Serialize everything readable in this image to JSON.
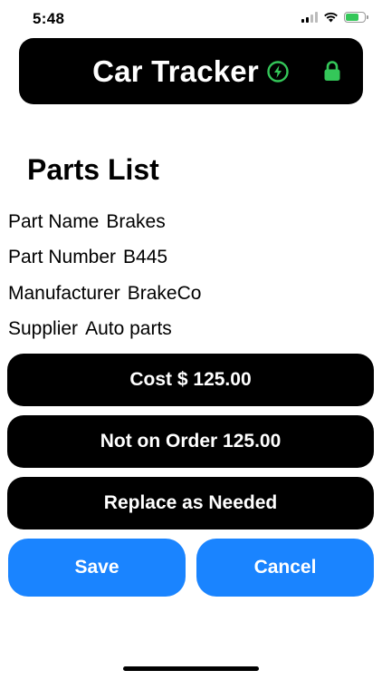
{
  "status": {
    "time": "5:48",
    "battery_color": "#34c759"
  },
  "header": {
    "title": "Car Tracker",
    "bolt_icon_color": "#34c759",
    "lock_icon_color": "#34c759"
  },
  "page_title": "Parts List",
  "fields": [
    {
      "label": "Part Name",
      "value": "Brakes"
    },
    {
      "label": "Part Number",
      "value": "B445"
    },
    {
      "label": "Manufacturer",
      "value": "BrakeCo"
    },
    {
      "label": "Supplier",
      "value": "Auto parts"
    }
  ],
  "pills": {
    "cost": "Cost $ 125.00",
    "order": "Not on Order 125.00",
    "replace": "Replace as Needed"
  },
  "buttons": {
    "save": "Save",
    "cancel": "Cancel",
    "color": "#1a84ff"
  }
}
